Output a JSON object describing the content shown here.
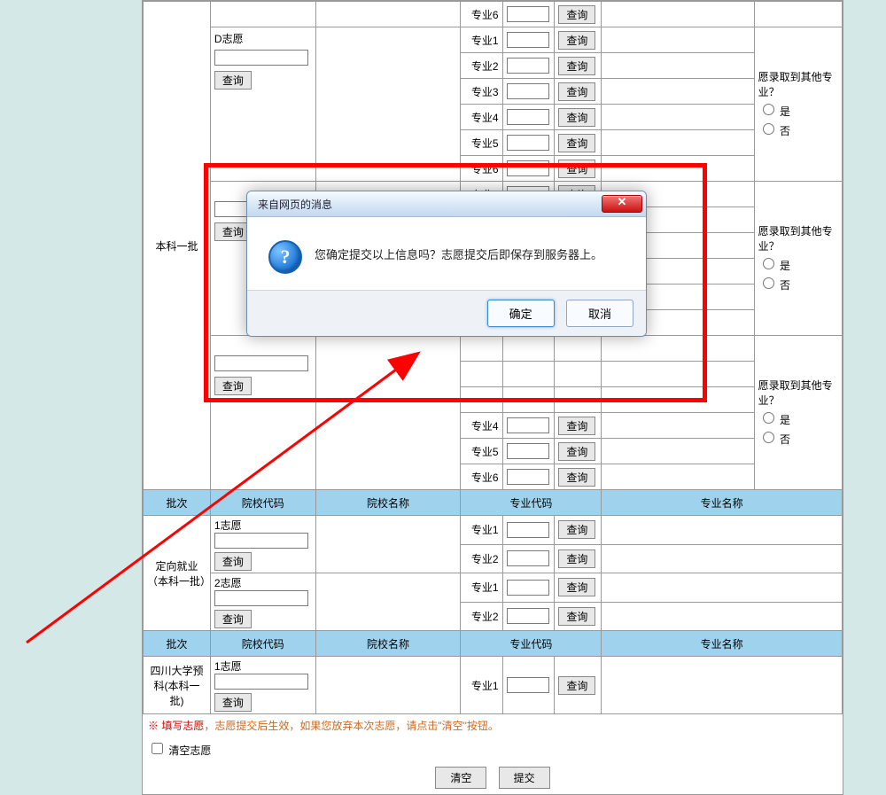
{
  "btn": {
    "query": "查询",
    "ok": "确定",
    "cancel": "取消",
    "clear": "清空",
    "submit": "提交"
  },
  "hdr": {
    "batch": "批次",
    "schoolCode": "院校代码",
    "schoolName": "院校名称",
    "majorCode": "专业代码",
    "majorName": "专业名称"
  },
  "lbl": {
    "m1": "专业1",
    "m2": "专业2",
    "m3": "专业3",
    "m4": "专业4",
    "m5": "专业5",
    "m6": "专业6",
    "opt_q": "愿录取到其他专业？",
    "yes": "是",
    "no": "否"
  },
  "batches": {
    "bk1": "本科一批",
    "dxjy": "定向就业（本科一批）",
    "scdx": "四川大学预科(本科一批)"
  },
  "wishes": {
    "d": "D志愿",
    "z1": "1志愿",
    "z2": "2志愿"
  },
  "dialog": {
    "title": "来自网页的消息",
    "message": "您确定提交以上信息吗？志愿提交后即保存到服务器上。",
    "icon": "?"
  },
  "note": {
    "star": "※",
    "lead": "填写志愿",
    "rest": "，志愿提交后生效，如果您放弃本次志愿，请点击\"清空\"按钮。"
  },
  "clearWish": "清空志愿"
}
